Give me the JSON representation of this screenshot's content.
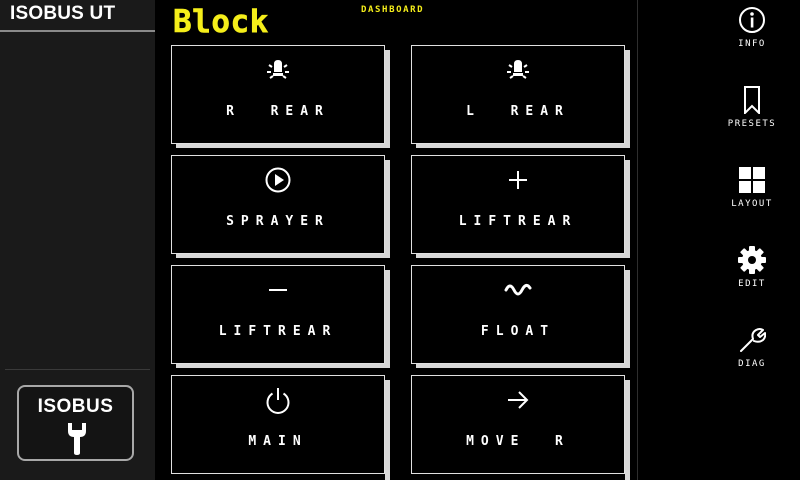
{
  "app": {
    "title": "ISOBUS UT",
    "isobus_button_label": "ISOBUS"
  },
  "header": {
    "title": "Block",
    "subtitle": "DASHBOARD"
  },
  "tiles": [
    {
      "label": "R  REAR",
      "icon": "work-light-icon"
    },
    {
      "label": "L  REAR",
      "icon": "work-light-icon"
    },
    {
      "label": "SPRAYER",
      "icon": "play-circle-icon"
    },
    {
      "label": "LIFTREAR",
      "icon": "plus-icon"
    },
    {
      "label": "LIFTREAR",
      "icon": "minus-icon"
    },
    {
      "label": "FLOAT",
      "icon": "float-wave-icon"
    },
    {
      "label": "MAIN",
      "icon": "power-icon"
    },
    {
      "label": "MOVE  R",
      "icon": "arrow-right-icon"
    }
  ],
  "sidebar_right": [
    {
      "label": "INFO",
      "icon": "info-icon"
    },
    {
      "label": "PRESETS",
      "icon": "bookmark-icon"
    },
    {
      "label": "LAYOUT",
      "icon": "grid-icon"
    },
    {
      "label": "EDIT",
      "icon": "gear-icon"
    },
    {
      "label": "DIAG",
      "icon": "wrench-icon"
    }
  ],
  "colors": {
    "accent": "#f5ee1a",
    "tile_border": "#e0e0e0",
    "panel": "#1a1a1a"
  }
}
